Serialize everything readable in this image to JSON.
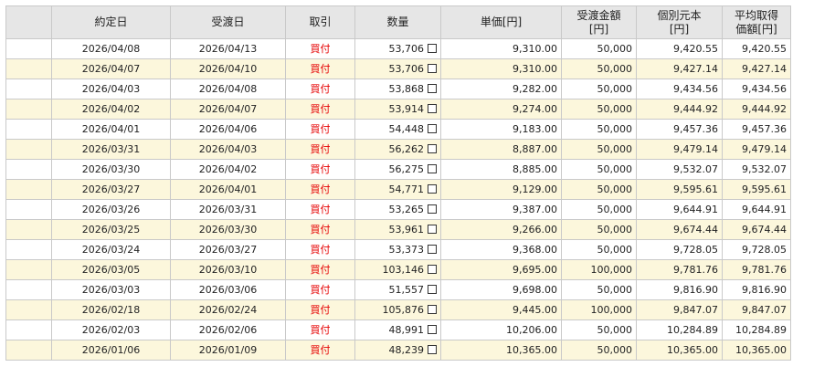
{
  "table": {
    "headers": [
      {
        "line1": "",
        "line2": ""
      },
      {
        "line1": "約定日",
        "line2": ""
      },
      {
        "line1": "受渡日",
        "line2": ""
      },
      {
        "line1": "取引",
        "line2": ""
      },
      {
        "line1": "数量",
        "line2": ""
      },
      {
        "line1": "単価[円]",
        "line2": ""
      },
      {
        "line1": "受渡金額",
        "line2": "[円]"
      },
      {
        "line1": "個別元本",
        "line2": "[円]"
      },
      {
        "line1": "平均取得",
        "line2": "価額[円]"
      }
    ],
    "rows": [
      {
        "trade_date": "2026/04/08",
        "settle_date": "2026/04/13",
        "kind": "買付",
        "qty": "53,706",
        "price": "9,310.00",
        "amount": "50,000",
        "principal": "9,420.55",
        "avg_cost": "9,420.55"
      },
      {
        "trade_date": "2026/04/07",
        "settle_date": "2026/04/10",
        "kind": "買付",
        "qty": "53,706",
        "price": "9,310.00",
        "amount": "50,000",
        "principal": "9,427.14",
        "avg_cost": "9,427.14"
      },
      {
        "trade_date": "2026/04/03",
        "settle_date": "2026/04/08",
        "kind": "買付",
        "qty": "53,868",
        "price": "9,282.00",
        "amount": "50,000",
        "principal": "9,434.56",
        "avg_cost": "9,434.56"
      },
      {
        "trade_date": "2026/04/02",
        "settle_date": "2026/04/07",
        "kind": "買付",
        "qty": "53,914",
        "price": "9,274.00",
        "amount": "50,000",
        "principal": "9,444.92",
        "avg_cost": "9,444.92"
      },
      {
        "trade_date": "2026/04/01",
        "settle_date": "2026/04/06",
        "kind": "買付",
        "qty": "54,448",
        "price": "9,183.00",
        "amount": "50,000",
        "principal": "9,457.36",
        "avg_cost": "9,457.36"
      },
      {
        "trade_date": "2026/03/31",
        "settle_date": "2026/04/03",
        "kind": "買付",
        "qty": "56,262",
        "price": "8,887.00",
        "amount": "50,000",
        "principal": "9,479.14",
        "avg_cost": "9,479.14"
      },
      {
        "trade_date": "2026/03/30",
        "settle_date": "2026/04/02",
        "kind": "買付",
        "qty": "56,275",
        "price": "8,885.00",
        "amount": "50,000",
        "principal": "9,532.07",
        "avg_cost": "9,532.07"
      },
      {
        "trade_date": "2026/03/27",
        "settle_date": "2026/04/01",
        "kind": "買付",
        "qty": "54,771",
        "price": "9,129.00",
        "amount": "50,000",
        "principal": "9,595.61",
        "avg_cost": "9,595.61"
      },
      {
        "trade_date": "2026/03/26",
        "settle_date": "2026/03/31",
        "kind": "買付",
        "qty": "53,265",
        "price": "9,387.00",
        "amount": "50,000",
        "principal": "9,644.91",
        "avg_cost": "9,644.91"
      },
      {
        "trade_date": "2026/03/25",
        "settle_date": "2026/03/30",
        "kind": "買付",
        "qty": "53,961",
        "price": "9,266.00",
        "amount": "50,000",
        "principal": "9,674.44",
        "avg_cost": "9,674.44"
      },
      {
        "trade_date": "2026/03/24",
        "settle_date": "2026/03/27",
        "kind": "買付",
        "qty": "53,373",
        "price": "9,368.00",
        "amount": "50,000",
        "principal": "9,728.05",
        "avg_cost": "9,728.05"
      },
      {
        "trade_date": "2026/03/05",
        "settle_date": "2026/03/10",
        "kind": "買付",
        "qty": "103,146",
        "price": "9,695.00",
        "amount": "100,000",
        "principal": "9,781.76",
        "avg_cost": "9,781.76"
      },
      {
        "trade_date": "2026/03/03",
        "settle_date": "2026/03/06",
        "kind": "買付",
        "qty": "51,557",
        "price": "9,698.00",
        "amount": "50,000",
        "principal": "9,816.90",
        "avg_cost": "9,816.90"
      },
      {
        "trade_date": "2026/02/18",
        "settle_date": "2026/02/24",
        "kind": "買付",
        "qty": "105,876",
        "price": "9,445.00",
        "amount": "100,000",
        "principal": "9,847.07",
        "avg_cost": "9,847.07"
      },
      {
        "trade_date": "2026/02/03",
        "settle_date": "2026/02/06",
        "kind": "買付",
        "qty": "48,991",
        "price": "10,206.00",
        "amount": "50,000",
        "principal": "10,284.89",
        "avg_cost": "10,284.89"
      },
      {
        "trade_date": "2026/01/06",
        "settle_date": "2026/01/09",
        "kind": "買付",
        "qty": "48,239",
        "price": "10,365.00",
        "amount": "50,000",
        "principal": "10,365.00",
        "avg_cost": "10,365.00"
      }
    ]
  }
}
